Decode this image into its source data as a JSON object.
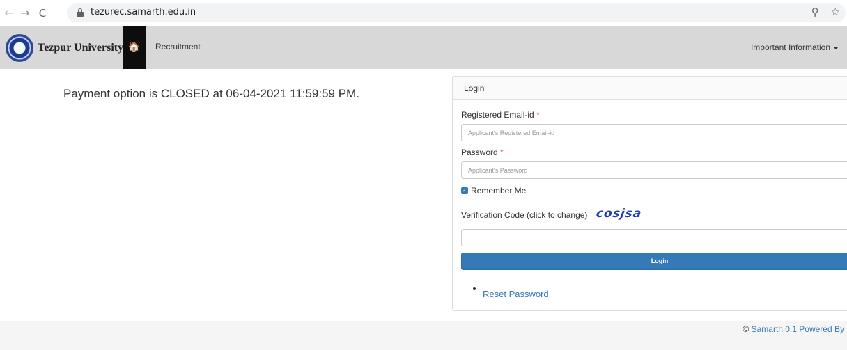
{
  "browser": {
    "url": "tezurec.samarth.edu.in",
    "back_icon": "←",
    "forward_icon": "→",
    "reload_icon": "C",
    "zoom_icon": "⚲",
    "star_icon": "☆"
  },
  "navbar": {
    "brand": "Tezpur University",
    "home_icon": "🏠",
    "link": "Recruitment",
    "right_menu": "Important Information"
  },
  "main": {
    "notice": "Payment option is CLOSED at 06-04-2021 11:59:59 PM."
  },
  "login": {
    "title": "Login",
    "email_label": "Registered Email-id",
    "email_placeholder": "Applicant's Registered Email-id",
    "password_label": "Password",
    "password_placeholder": "Applicant's Password",
    "required_mark": "*",
    "remember_label": "Remember Me",
    "remember_checked": true,
    "verification_label": "Verification Code (click to change)",
    "captcha_text": "cosjsa",
    "verification_value": "",
    "button_label": "Login",
    "reset_link": "Reset Password"
  },
  "footer": {
    "copyright_symbol": "©",
    "text": "Samarth 0.1 Powered By"
  },
  "colors": {
    "navbar_bg": "#d8d8d8",
    "primary": "#337ab7",
    "required": "#d9534f"
  }
}
